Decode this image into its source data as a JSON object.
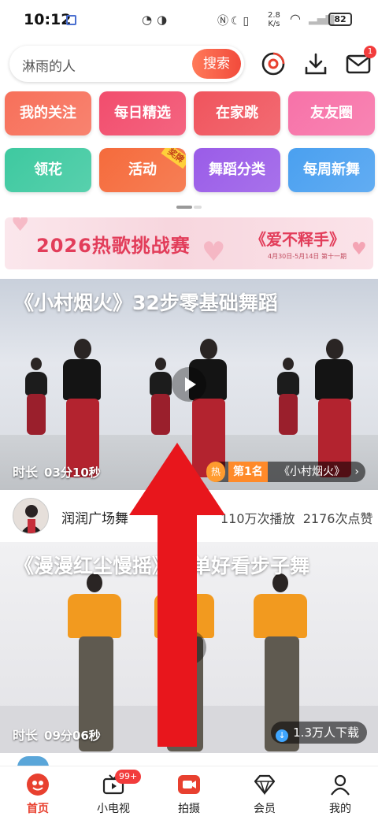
{
  "status_bar": {
    "time": "10:12",
    "net_speed_value": "2.8",
    "net_speed_unit": "K/s",
    "battery": "82"
  },
  "search": {
    "placeholder": "淋雨的人",
    "button_label": "搜索",
    "icons": [
      "music-disc-icon",
      "download-icon",
      "mail-icon"
    ],
    "mail_badge": "1"
  },
  "categories": [
    {
      "label": "我的关注",
      "color": "#f7705a"
    },
    {
      "label": "每日精选",
      "color": "#f24d6d"
    },
    {
      "label": "在家跳",
      "color": "#f0545d"
    },
    {
      "label": "友友圈",
      "color": "#f772a8"
    },
    {
      "label": "领花",
      "color": "#3ec9a0"
    },
    {
      "label": "活动",
      "color": "#f56b3c",
      "ribbon": "奖牌"
    },
    {
      "label": "舞蹈分类",
      "color": "#9a5ce8"
    },
    {
      "label": "每周新舞",
      "color": "#4aa0f0"
    }
  ],
  "banner": {
    "title": "2026热歌挑战赛",
    "song": "《爱不释手》",
    "subtitle": "4月30日-5月14日 第十一期"
  },
  "videos": [
    {
      "title": "《小村烟火》32步零基础舞蹈",
      "duration_label": "时长",
      "duration": "03分10秒",
      "hot_tag": "热",
      "rank": "第1名",
      "rank_song": "《小村烟火》",
      "author": "润润广场舞",
      "plays": "110万次播放",
      "likes": "2176次点赞"
    },
    {
      "title": "《漫漫红尘慢摇》简单好看步子舞",
      "duration_label": "时长",
      "duration": "09分06秒",
      "downloads": "1.3万人下载"
    }
  ],
  "tabbar": [
    {
      "label": "首页",
      "icon": "home-icon",
      "active": true
    },
    {
      "label": "小电视",
      "icon": "tv-icon",
      "badge": "99+"
    },
    {
      "label": "拍摄",
      "icon": "camera-icon"
    },
    {
      "label": "会员",
      "icon": "diamond-icon"
    },
    {
      "label": "我的",
      "icon": "profile-icon"
    }
  ],
  "colors": {
    "accent": "#e8402f",
    "overlay_arrow": "#e8161c"
  }
}
